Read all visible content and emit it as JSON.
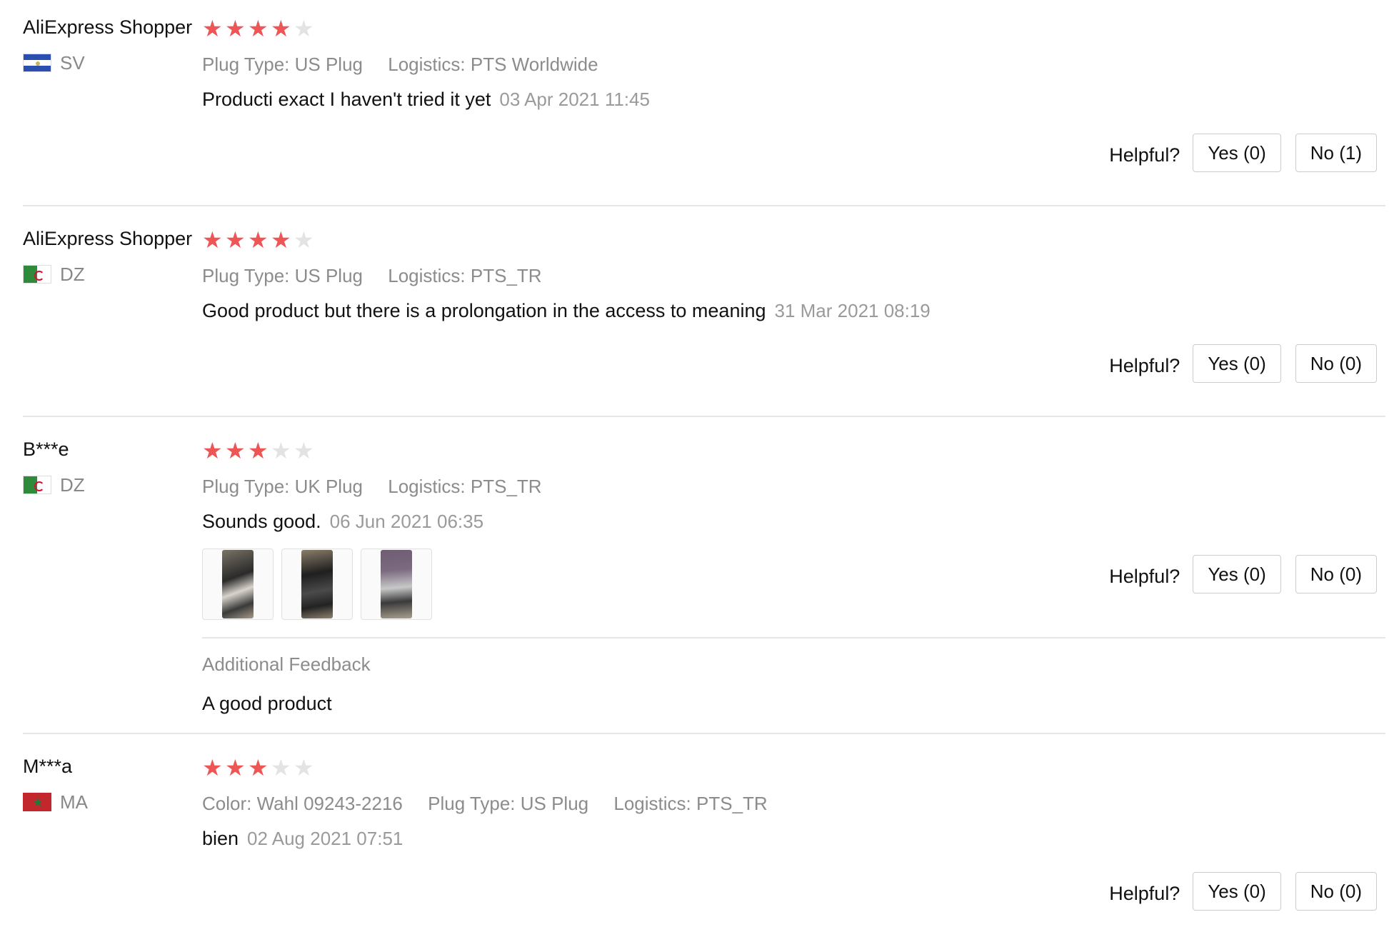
{
  "reviews": [
    {
      "user": "AliExpress Shopper",
      "country": "SV",
      "flag_icon": "el-salvador-flag-icon",
      "rating": 4,
      "meta": [
        {
          "label": "Plug Type:",
          "value": "US Plug"
        },
        {
          "label": "Logistics:",
          "value": "PTS Worldwide"
        }
      ],
      "comment": "Producti exact I haven't tried it yet",
      "date": "03 Apr 2021 11:45",
      "helpful_label": "Helpful?",
      "yes_label": "Yes (0)",
      "no_label": "No (1)"
    },
    {
      "user": "AliExpress Shopper",
      "country": "DZ",
      "flag_icon": "algeria-flag-icon",
      "rating": 4,
      "meta": [
        {
          "label": "Plug Type:",
          "value": "US Plug"
        },
        {
          "label": "Logistics:",
          "value": "PTS_TR"
        }
      ],
      "comment": "Good product but there is a prolongation in the access to meaning",
      "date": "31 Mar 2021 08:19",
      "helpful_label": "Helpful?",
      "yes_label": "Yes (0)",
      "no_label": "No (0)"
    },
    {
      "user": "B***e",
      "country": "DZ",
      "flag_icon": "algeria-flag-icon",
      "rating": 3,
      "meta": [
        {
          "label": "Plug Type:",
          "value": "UK Plug"
        },
        {
          "label": "Logistics:",
          "value": "PTS_TR"
        }
      ],
      "comment": "Sounds good.",
      "date": "06 Jun 2021 06:35",
      "photos": [
        "review-photo-icon",
        "review-photo-icon",
        "review-photo-icon"
      ],
      "additional_feedback_title": "Additional Feedback",
      "additional_feedback_text": "A good product",
      "helpful_label": "Helpful?",
      "yes_label": "Yes (0)",
      "no_label": "No (0)"
    },
    {
      "user": "M***a",
      "country": "MA",
      "flag_icon": "morocco-flag-icon",
      "rating": 3,
      "meta": [
        {
          "label": "Color:",
          "value": "Wahl 09243-2216"
        },
        {
          "label": "Plug Type:",
          "value": "US Plug"
        },
        {
          "label": "Logistics:",
          "value": "PTS_TR"
        }
      ],
      "comment": "bien",
      "date": "02 Aug 2021 07:51",
      "helpful_label": "Helpful?",
      "yes_label": "Yes (0)",
      "no_label": "No (0)"
    }
  ],
  "star_icon": "star-icon",
  "colors": {
    "star_filled": "#ee5555",
    "star_empty": "#e3e3e3",
    "muted_text": "#8c8c8c",
    "divider": "#e6e6e6"
  }
}
